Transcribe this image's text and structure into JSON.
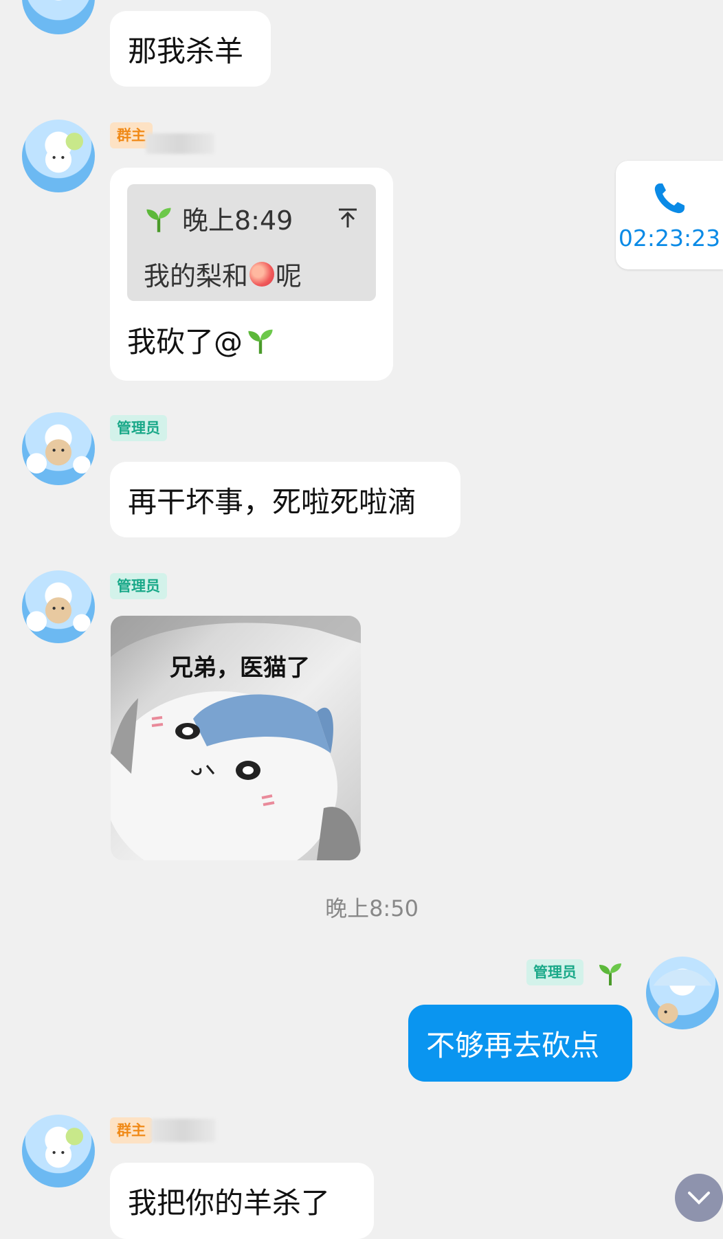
{
  "messages": {
    "m1": {
      "text": "那我杀羊"
    },
    "m2": {
      "badge": "群主",
      "quote_time": "晚上8:49",
      "quote_text_before": "我的梨和",
      "quote_text_after": "呢",
      "text": "我砍了@"
    },
    "m3": {
      "badge": "管理员",
      "text": "再干坏事，死啦死啦滴"
    },
    "m4": {
      "badge": "管理员",
      "sticker_caption": "兄弟，医猫了"
    },
    "separator": {
      "time": "晚上8:50"
    },
    "m5": {
      "badge": "管理员",
      "text": "不够再去砍点"
    },
    "m6": {
      "badge": "群主",
      "text": "我把你的羊杀了"
    }
  },
  "call": {
    "duration": "02:23:23",
    "icon": "phone-icon"
  },
  "icons": {
    "sprout": "sprout-icon",
    "peach": "peach-emoji",
    "pin": "pin-to-top-icon",
    "scroll_down": "chevron-down-icon"
  },
  "colors": {
    "background": "#f0f0f0",
    "my_bubble": "#0a95f0",
    "owner_badge": "#f08a18",
    "admin_badge": "#19a888",
    "call_accent": "#0a8ae6"
  }
}
